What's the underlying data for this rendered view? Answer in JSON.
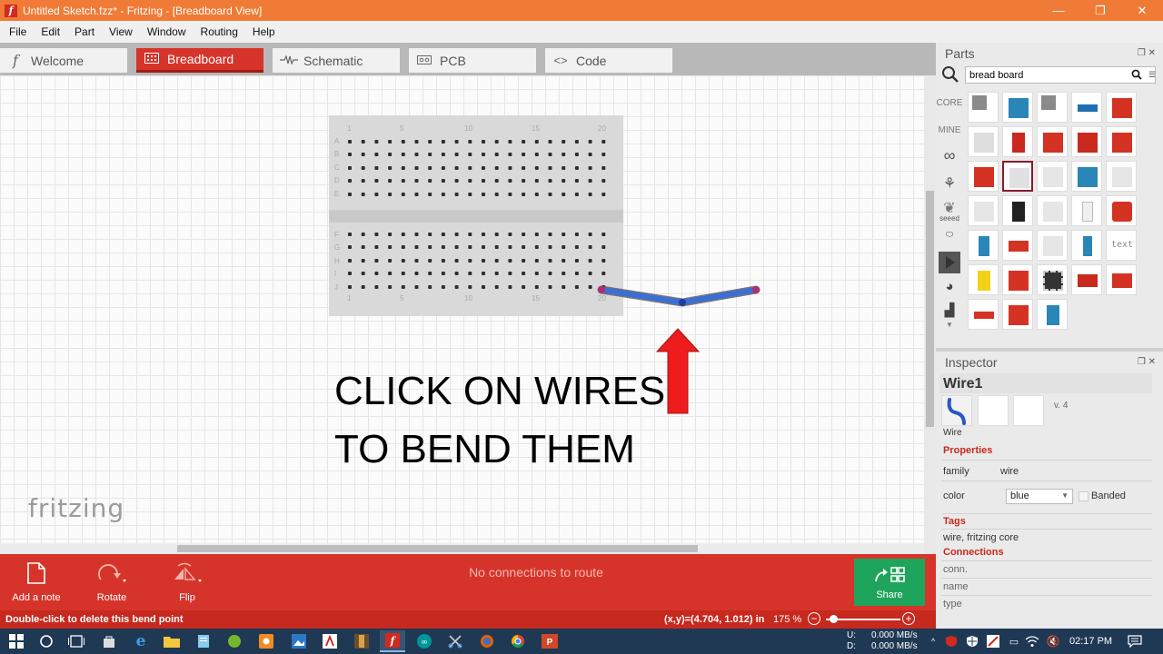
{
  "window": {
    "title": "Untitled Sketch.fzz* - Fritzing - [Breadboard View]",
    "controls": {
      "minimize": "—",
      "restore": "❐",
      "close": "✕"
    }
  },
  "menu": [
    "File",
    "Edit",
    "Part",
    "View",
    "Window",
    "Routing",
    "Help"
  ],
  "tabs": [
    {
      "label": "Welcome",
      "icon": "fritzing-f-icon",
      "active": false
    },
    {
      "label": "Breadboard",
      "icon": "breadboard-icon",
      "active": true
    },
    {
      "label": "Schematic",
      "icon": "resistor-icon",
      "active": false
    },
    {
      "label": "PCB",
      "icon": "pcb-icon",
      "active": false
    },
    {
      "label": "Code",
      "icon": "code-icon",
      "active": false
    }
  ],
  "canvas": {
    "breadboard": {
      "row_labels_top": [
        "A",
        "B",
        "C",
        "D",
        "E"
      ],
      "row_labels_bottom": [
        "F",
        "G",
        "H",
        "I",
        "J"
      ],
      "col_labels": [
        "1",
        "5",
        "10",
        "15",
        "20"
      ]
    },
    "instruction_lines": [
      "CLICK ON WIRES",
      "TO BEND THEM"
    ],
    "logo_text": "fritzing",
    "wire_color": "#3a6fd8"
  },
  "toolbar": {
    "add_note": "Add a note",
    "rotate": "Rotate",
    "flip": "Flip",
    "routing_status": "No connections to route",
    "share": "Share"
  },
  "status": {
    "message": "Double-click to delete this bend point",
    "coords": "(x,y)=(4.704, 1.012) in",
    "zoom": "175 %",
    "zoom_minus": "−",
    "zoom_plus": "+"
  },
  "parts": {
    "header": "Parts",
    "search_value": "bread board",
    "bins": [
      "CORE",
      "MINE",
      "seeed"
    ],
    "text_part_label": "text"
  },
  "inspector": {
    "header": "Inspector",
    "title": "Wire1",
    "version": "v. 4",
    "icon_caption": "Wire",
    "properties_label": "Properties",
    "family_label": "family",
    "family_value": "wire",
    "color_label": "color",
    "color_value": "blue",
    "banded_label": "Banded",
    "tags_label": "Tags",
    "tags_value": "wire, fritzing core",
    "connections_label": "Connections",
    "conn_label": "conn.",
    "name_label": "name",
    "type_label": "type"
  },
  "taskbar": {
    "net_up_label": "U:",
    "net_up": "0.000 MB/s",
    "net_down_label": "D:",
    "net_down": "0.000 MB/s",
    "clock": "02:17 PM"
  },
  "colors": {
    "accent_red": "#d6342a",
    "title_orange": "#f07b36",
    "share_green": "#1fa55b",
    "taskbar": "#1f3954"
  }
}
